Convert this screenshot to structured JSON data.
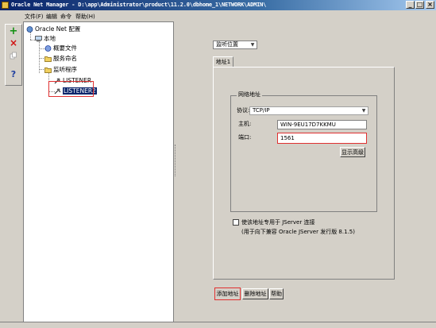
{
  "window": {
    "title": "Oracle Net Manager - D:\\app\\Administrator\\product\\11.2.0\\dbhome_1\\NETWORK\\ADMIN\\",
    "minimize_label": "_",
    "maximize_label": "□",
    "close_label": "×"
  },
  "menu": {
    "items": [
      {
        "label": "文件(F)"
      },
      {
        "label": "编辑"
      },
      {
        "label": "命令"
      },
      {
        "label": "帮助(H)"
      }
    ]
  },
  "toolbar": {
    "add_label": "+",
    "delete_label": "×",
    "help_label": "?"
  },
  "tree": {
    "root": "Oracle Net 配置",
    "local": "本地",
    "profile": "概要文件",
    "service_naming": "服务命名",
    "listeners": "监听程序",
    "listener1": "LISTENER",
    "listener2": "LISTENER2"
  },
  "view_select": {
    "value": "监听位置"
  },
  "tab": {
    "label": "地址1"
  },
  "network_address": {
    "title": "网络地址",
    "protocol_label": "协议:",
    "protocol_value": "TCP/IP",
    "host_label": "主机:",
    "host_value": "WIN-9EU17D7KKMU",
    "port_label": "端口:",
    "port_value": "1561",
    "show_advanced_label": "显示高级"
  },
  "jserver": {
    "checkbox_label": "使该地址专用于 JServer 连接",
    "note": "(用于向下兼容 Oracle JServer 发行版 8.1.5)",
    "checked": false
  },
  "actions": {
    "add_address": "添加地址",
    "remove_address": "删除地址",
    "help": "帮助"
  },
  "colors": {
    "accent_highlight": "#e03030",
    "selection": "#0a246a"
  }
}
